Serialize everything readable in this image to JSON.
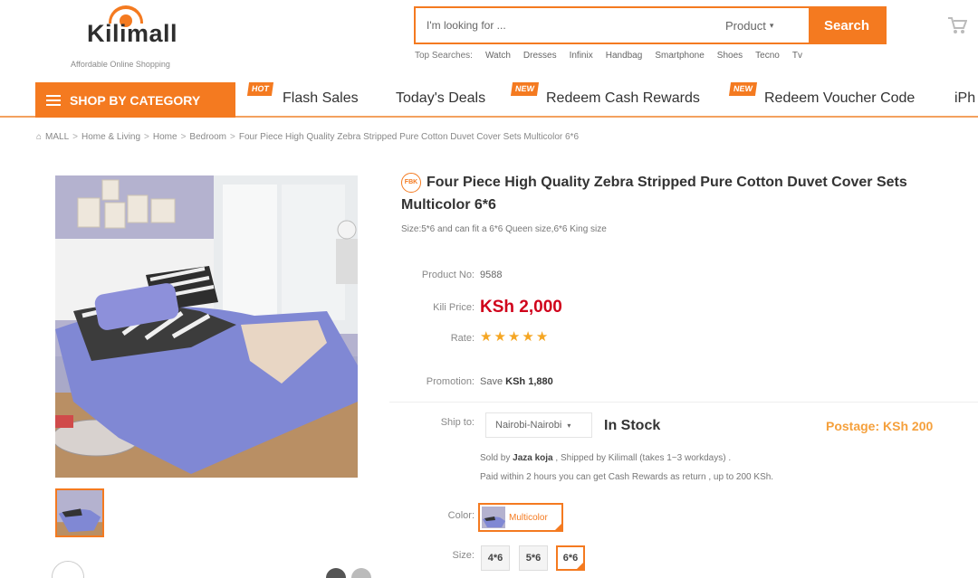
{
  "header": {
    "logo_text": "Kilimall",
    "logo_tagline": "Affordable Online Shopping",
    "search": {
      "placeholder": "I'm looking for ...",
      "category": "Product",
      "button": "Search"
    },
    "top_searches_label": "Top Searches:",
    "top_searches": [
      "Watch",
      "Dresses",
      "Infinix",
      "Handbag",
      "Smartphone",
      "Shoes",
      "Tecno",
      "Tv"
    ]
  },
  "nav": {
    "shop_by_category": "SHOP BY CATEGORY",
    "links": [
      {
        "label": "Flash Sales",
        "badge": "HOT"
      },
      {
        "label": "Today's Deals",
        "badge": ""
      },
      {
        "label": "Redeem Cash Rewards",
        "badge": "NEW"
      },
      {
        "label": "Redeem Voucher Code",
        "badge": "NEW"
      },
      {
        "label": "iPh",
        "badge": ""
      }
    ]
  },
  "breadcrumb": [
    "MALL",
    "Home & Living",
    "Home",
    "Bedroom",
    "Four Piece High Quality Zebra Stripped Pure Cotton Duvet Cover Sets Multicolor 6*6"
  ],
  "product": {
    "badge": "FBK",
    "title": "Four Piece High Quality Zebra Stripped Pure Cotton Duvet Cover Sets Multicolor 6*6",
    "subtitle": "Size:5*6 and can fit a 6*6 Queen size,6*6 King size",
    "product_no_label": "Product No:",
    "product_no": "9588",
    "price_label": "Kili Price:",
    "price": "KSh 2,000",
    "rate_label": "Rate:",
    "rating": 5,
    "promotion_label": "Promotion:",
    "promotion_text": "Save",
    "promotion_amount": "KSh 1,880",
    "ship_label": "Ship to:",
    "ship_to": "Nairobi-Nairobi",
    "stock": "In Stock",
    "postage": "Postage: KSh 200",
    "sold_by_prefix": "Sold by",
    "seller": "Jaza koja",
    "sold_by_suffix": ", Shipped by Kilimall (takes 1~3 workdays) .",
    "paid_line": "Paid within 2 hours you can get Cash Rewards as return , up to 200 KSh.",
    "color_label": "Color:",
    "color": "Multicolor",
    "size_label": "Size:",
    "sizes": [
      "4*6",
      "5*6",
      "6*6"
    ],
    "selected_size": "6*6"
  },
  "colors": {
    "brand": "#f47a20",
    "price": "#d0021b",
    "postage": "#f5a03c"
  }
}
